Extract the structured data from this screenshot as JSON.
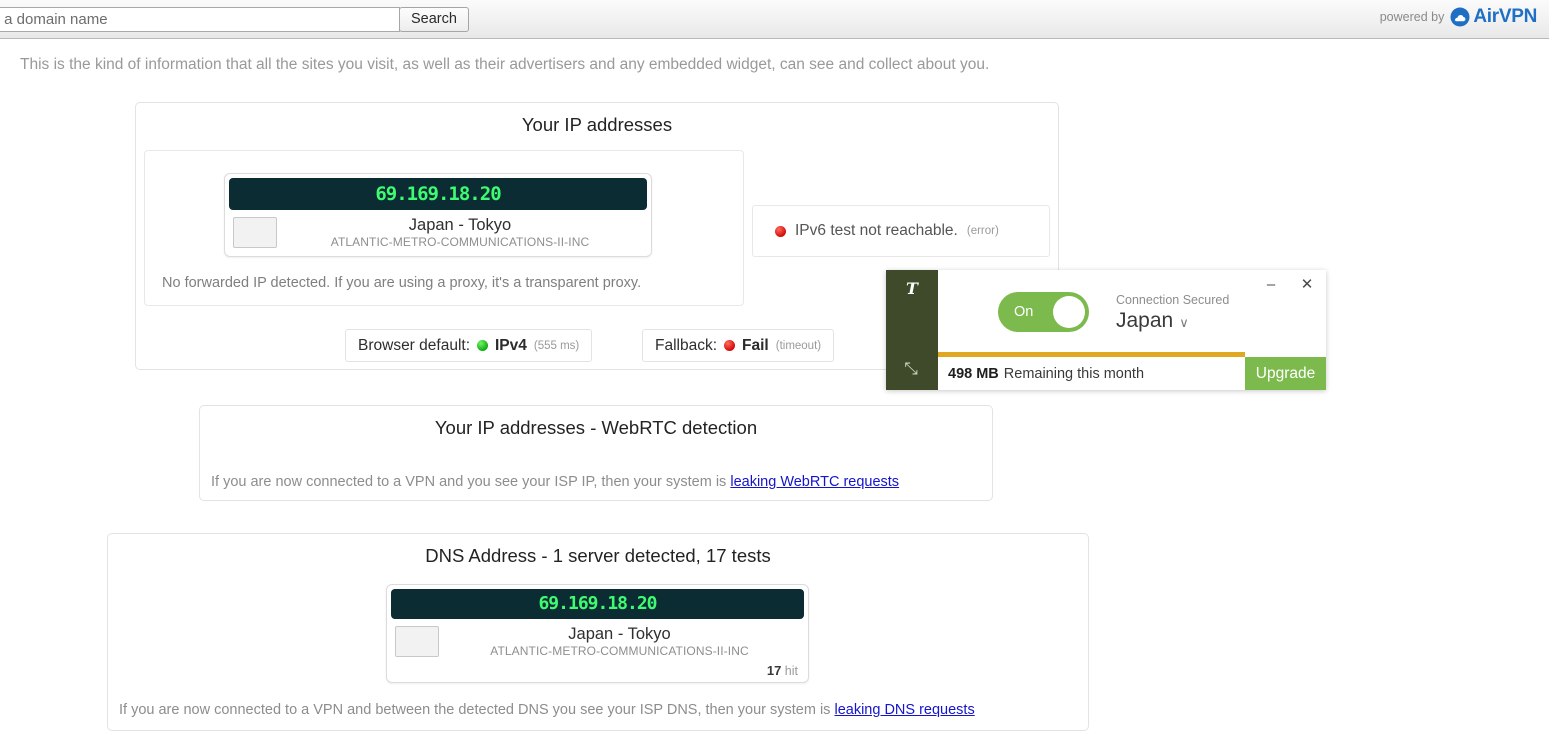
{
  "header": {
    "search_value": "",
    "search_placeholder": "r a domain name",
    "search_button": "Search",
    "powered_by_label": "powered by",
    "brand_name": "AirVPN",
    "brand_color": "#1f6fc4"
  },
  "intro": "This is the kind of information that all the sites you visit, as well as their advertisers and any embedded widget, can see and collect about you.",
  "ip_panel": {
    "title": "Your IP addresses",
    "card": {
      "ip": "69.169.18.20",
      "location": "Japan - Tokyo",
      "isp": "ATLANTIC-METRO-COMMUNICATIONS-II-INC"
    },
    "forwarded_note": "No forwarded IP detected. If you are using a proxy, it's a transparent proxy.",
    "ipv6": {
      "text": "IPv6 test not reachable.",
      "detail": "(error)",
      "status_color": "#d40b0b"
    },
    "status": [
      {
        "label": "Browser default:",
        "value": "IPv4",
        "detail": "(555 ms)",
        "status_color": "#0fae0f"
      },
      {
        "label": "Fallback:",
        "value": "Fail",
        "detail": "(timeout)",
        "status_color": "#d40b0b"
      }
    ]
  },
  "webrtc_panel": {
    "title": "Your IP addresses - WebRTC detection",
    "message": "If you are now connected to a VPN and you see your ISP IP, then your system is",
    "link": "leaking WebRTC requests"
  },
  "dns_panel": {
    "title": "DNS Address - 1 server detected, 17 tests",
    "card": {
      "ip": "69.169.18.20",
      "location": "Japan - Tokyo",
      "isp": "ATLANTIC-METRO-COMMUNICATIONS-II-INC",
      "hit_count": "17",
      "hit_label": "hit"
    },
    "message": "If you are now connected to a VPN and between the detected DNS you see your ISP DNS, then your system is",
    "link": "leaking DNS requests"
  },
  "vpn_widget": {
    "app_logo": "T",
    "minimize": "–",
    "close": "✕",
    "resize": "⤡",
    "toggle_label": "On",
    "toggle_on": true,
    "connection_status": "Connection Secured",
    "country": "Japan",
    "chevron": "∨",
    "data_amount": "498 MB",
    "data_text": "Remaining this month",
    "upgrade_label": "Upgrade",
    "accent_green": "#7dba4e",
    "bar_color": "#e0a820",
    "sidebar_color": "#3f4a2b"
  }
}
